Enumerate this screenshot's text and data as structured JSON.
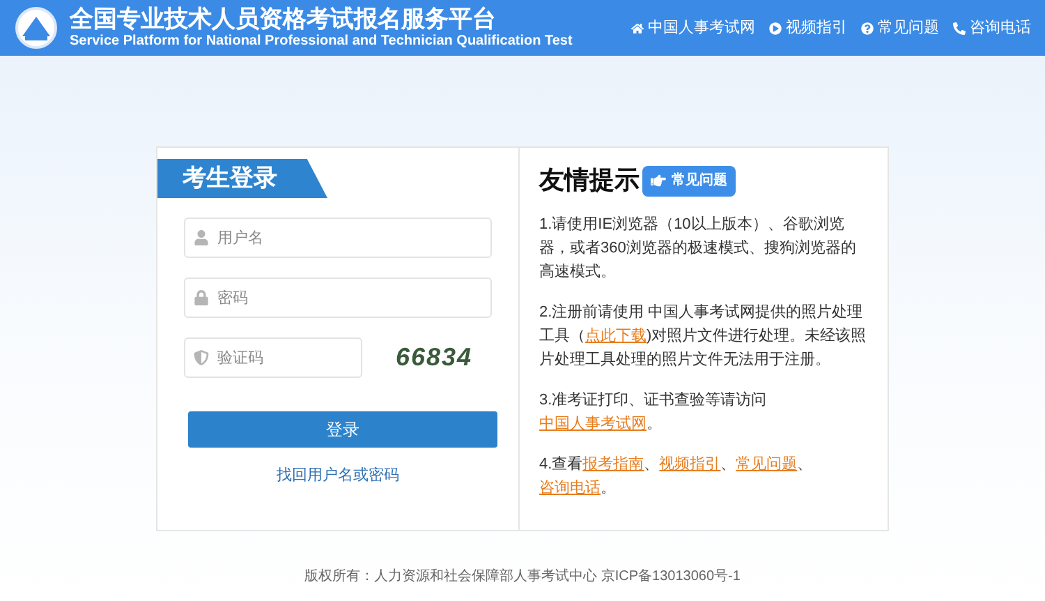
{
  "header": {
    "title": "全国专业技术人员资格考试报名服务平台",
    "subtitle": "Service Platform for National Professional and Technician Qualification Test",
    "links": [
      {
        "kind": "home",
        "label": "中国人事考试网"
      },
      {
        "kind": "play",
        "label": "视频指引"
      },
      {
        "kind": "help",
        "label": "常见问题"
      },
      {
        "kind": "phone",
        "label": "咨询电话"
      }
    ]
  },
  "login": {
    "title": "考生登录",
    "fields": [
      {
        "kind": "user",
        "placeholder": "用户名"
      },
      {
        "kind": "lock",
        "placeholder": "密码"
      },
      {
        "kind": "shield",
        "placeholder": "验证码"
      }
    ],
    "captcha": "66834",
    "submit": "登录",
    "recover": "找回用户名或密码"
  },
  "tips": {
    "title": "友情提示",
    "faq_button": "常见问题",
    "items": [
      [
        {
          "text": "1.请使用IE浏览器（10以上版本）、谷歌浏览器，或者360浏览器的极速模式、搜狗浏览器的高速模式。"
        }
      ],
      [
        {
          "text": "2.注册前请使用 中国人事考试网提供的照片处理工具（"
        },
        {
          "text": "点此下载",
          "link": true
        },
        {
          "text": ")对照片文件进行处理。未经该照片处理工具处理的照片文件无法用于注册。"
        }
      ],
      [
        {
          "text": "3.准考证打印、证书查验等请访问"
        },
        {
          "text": "中国人事考试网",
          "link": true
        },
        {
          "text": "。"
        }
      ],
      [
        {
          "text": "4.查看"
        },
        {
          "text": "报考指南",
          "link": true
        },
        {
          "text": "、"
        },
        {
          "text": "视频指引",
          "link": true
        },
        {
          "text": "、"
        },
        {
          "text": "常见问题",
          "link": true
        },
        {
          "text": "、"
        },
        {
          "text": "咨询电话",
          "link": true
        },
        {
          "text": "。"
        }
      ]
    ]
  },
  "footer": "版权所有：人力资源和社会保障部人事考试中心 京ICP备13013060号-1"
}
